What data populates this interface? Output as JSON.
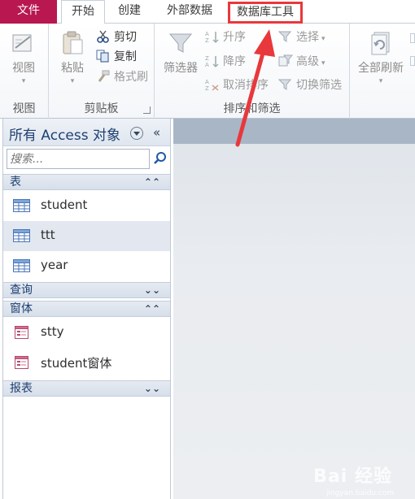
{
  "tabs": [
    {
      "label": "文件"
    },
    {
      "label": "开始"
    },
    {
      "label": "创建"
    },
    {
      "label": "外部数据"
    },
    {
      "label": "数据库工具"
    }
  ],
  "ribbon": {
    "view_group": {
      "button": "视图",
      "label": "视图"
    },
    "clipboard_group": {
      "paste": "粘贴",
      "cut": "剪切",
      "copy": "复制",
      "format_painter": "格式刷",
      "label": "剪贴板"
    },
    "sort_group": {
      "filter": "筛选器",
      "ascending": "升序",
      "descending": "降序",
      "clear_sort": "取消排序",
      "selection": "选择",
      "advanced": "高级",
      "toggle_filter": "切换筛选",
      "label": "排序和筛选"
    },
    "records_group": {
      "refresh_all": "全部刷新"
    }
  },
  "nav": {
    "title": "所有 Access 对象",
    "collapse_glyph": "«",
    "search_placeholder": "搜索...",
    "sections": {
      "tables": {
        "label": "表",
        "chevron": "⌃⌃"
      },
      "queries": {
        "label": "查询",
        "chevron": "⌄⌄"
      },
      "forms": {
        "label": "窗体",
        "chevron": "⌃⌃"
      },
      "reports": {
        "label": "报表",
        "chevron": "⌄⌄"
      }
    },
    "tables": [
      "student",
      "ttt",
      "year"
    ],
    "forms": [
      "stty",
      "student窗体"
    ]
  },
  "watermark": {
    "text": "Bai 经验",
    "sub": "jingyan.baidu.com"
  },
  "colors": {
    "file_tab": "#b8174f",
    "nav_title": "#1e3f71",
    "annotation": "#e8383b"
  }
}
